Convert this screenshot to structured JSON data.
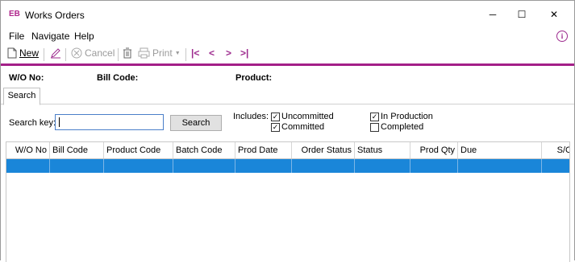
{
  "window": {
    "app_badge": "EB",
    "title": "Works Orders",
    "controls": {
      "minimize": "─",
      "maximize": "☐",
      "close": "✕"
    }
  },
  "menu": {
    "file": "File",
    "navigate": "Navigate",
    "help": "Help"
  },
  "toolbar": {
    "new_label": "New",
    "cancel_label": "Cancel",
    "print_label": "Print",
    "first": "|<",
    "prev": "<",
    "next": ">",
    "last": ">|"
  },
  "header": {
    "wo_no_label": "W/O No:",
    "bill_code_label": "Bill Code:",
    "product_label": "Product:"
  },
  "tabs": [
    {
      "label": "Search"
    }
  ],
  "search": {
    "key_label": "Search key:",
    "value": "",
    "button_label": "Search",
    "includes_label": "Includes:",
    "filters": [
      {
        "label": "Uncommitted",
        "checked": true
      },
      {
        "label": "Committed",
        "checked": true
      },
      {
        "label": "In Production",
        "checked": true
      },
      {
        "label": "Completed",
        "checked": false
      }
    ]
  },
  "grid": {
    "columns": [
      "W/O No",
      "Bill Code",
      "Product Code",
      "Batch Code",
      "Prod Date",
      "Order Status",
      "Status",
      "Prod Qty",
      "Due",
      "S/C"
    ],
    "rows": []
  },
  "colors": {
    "accent": "#a31f88",
    "selection": "#1a86d9"
  }
}
